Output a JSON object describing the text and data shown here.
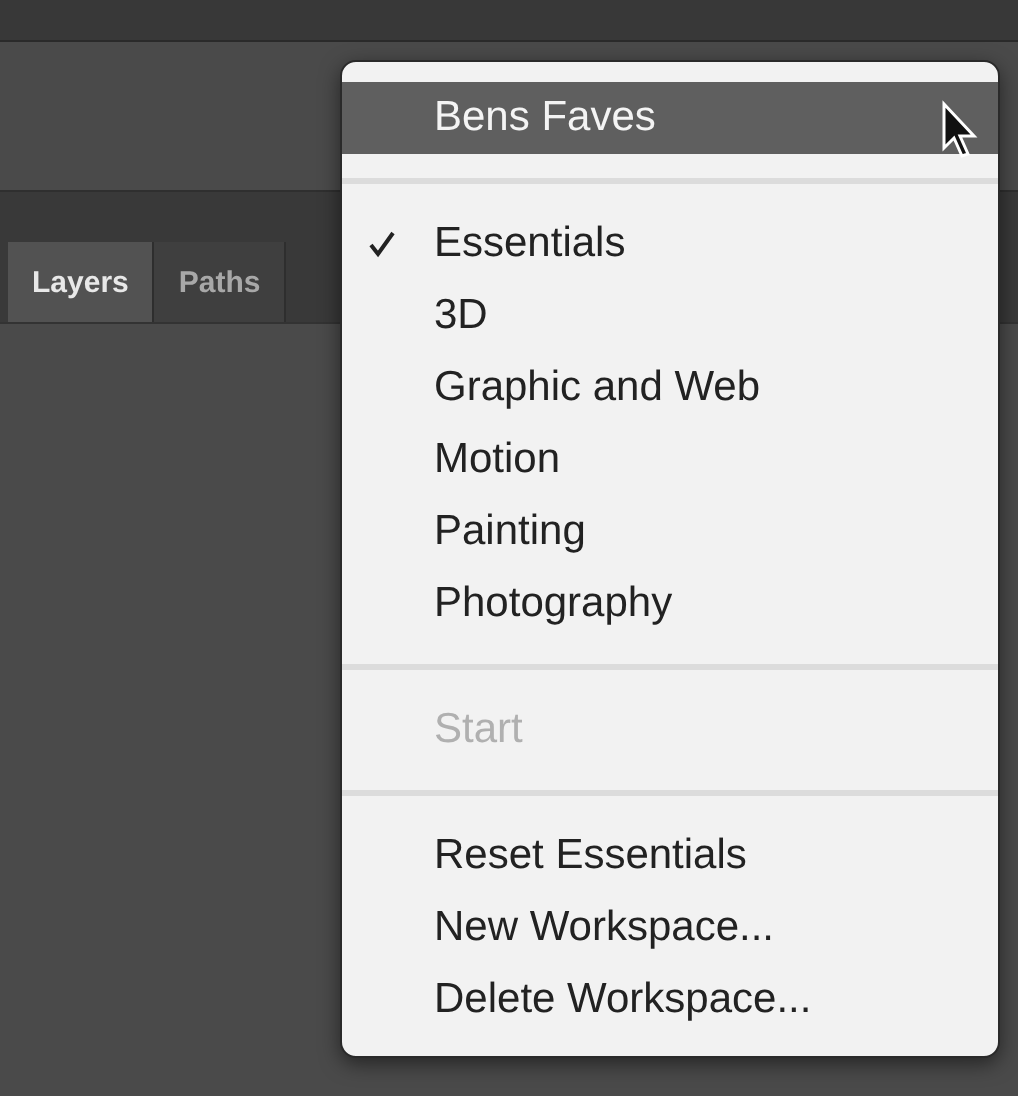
{
  "panel": {
    "tabs": [
      {
        "label": "Layers",
        "selected": true
      },
      {
        "label": "Paths",
        "selected": false
      }
    ]
  },
  "workspace_menu": {
    "sections": [
      {
        "items": [
          {
            "label": "Bens Faves",
            "highlighted": true,
            "checked": false,
            "disabled": false
          }
        ]
      },
      {
        "items": [
          {
            "label": "Essentials",
            "highlighted": false,
            "checked": true,
            "disabled": false
          },
          {
            "label": "3D",
            "highlighted": false,
            "checked": false,
            "disabled": false
          },
          {
            "label": "Graphic and Web",
            "highlighted": false,
            "checked": false,
            "disabled": false
          },
          {
            "label": "Motion",
            "highlighted": false,
            "checked": false,
            "disabled": false
          },
          {
            "label": "Painting",
            "highlighted": false,
            "checked": false,
            "disabled": false
          },
          {
            "label": "Photography",
            "highlighted": false,
            "checked": false,
            "disabled": false
          }
        ]
      },
      {
        "items": [
          {
            "label": "Start",
            "highlighted": false,
            "checked": false,
            "disabled": true
          }
        ]
      },
      {
        "items": [
          {
            "label": "Reset Essentials",
            "highlighted": false,
            "checked": false,
            "disabled": false
          },
          {
            "label": "New Workspace...",
            "highlighted": false,
            "checked": false,
            "disabled": false
          },
          {
            "label": "Delete Workspace...",
            "highlighted": false,
            "checked": false,
            "disabled": false
          }
        ]
      }
    ]
  }
}
